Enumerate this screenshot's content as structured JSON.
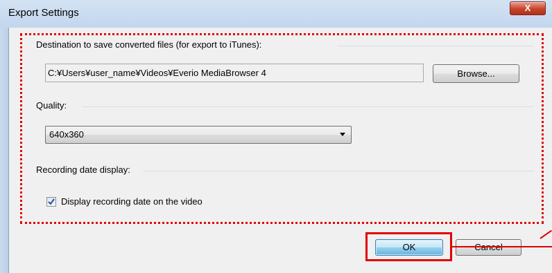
{
  "window": {
    "title": "Export Settings",
    "close_glyph": "X"
  },
  "destination": {
    "label": "Destination to save converted files (for export to iTunes):",
    "path": "C:¥Users¥user_name¥Videos¥Everio MediaBrowser 4",
    "browse_label": "Browse..."
  },
  "quality": {
    "label": "Quality:",
    "selected": "640x360"
  },
  "recording_date": {
    "label": "Recording date display:",
    "checkbox_label": "Display recording date on the video",
    "checked": true
  },
  "buttons": {
    "ok_label": "OK",
    "cancel_label": "Cancel"
  },
  "colors": {
    "highlight": "#e00000",
    "ok_accent": "#3c7fb1"
  }
}
